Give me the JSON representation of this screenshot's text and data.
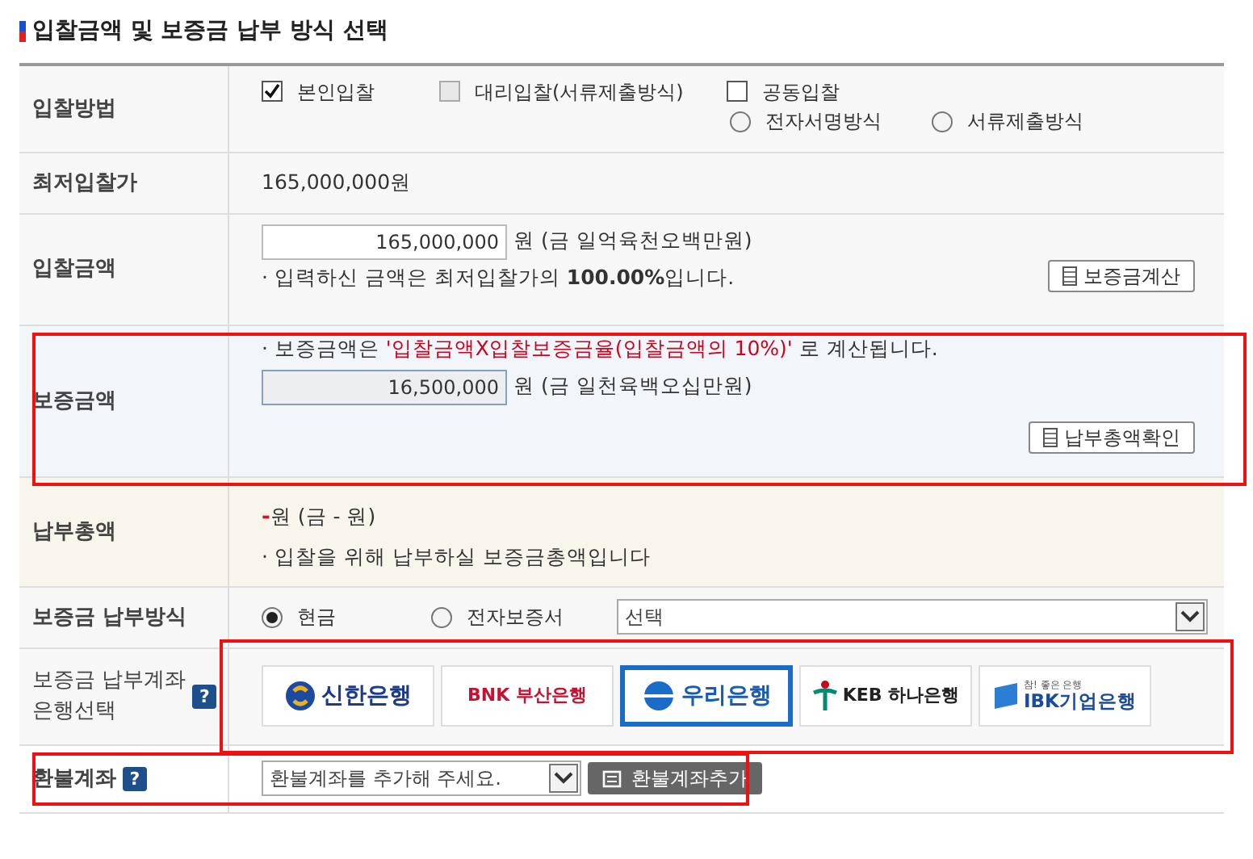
{
  "section_title": "입찰금액 및 보증금 납부 방식 선택",
  "rows": [
    {
      "kind": "bid-method",
      "label": "입찰방법",
      "highlighted": false,
      "options": [
        {
          "label": "본인입찰",
          "checked": true,
          "disabled": false
        },
        {
          "label": "대리입찰(서류제출방식)",
          "checked": false,
          "disabled": true
        },
        {
          "label": "공동입찰",
          "checked": false,
          "disabled": false
        }
      ],
      "sub_options": [
        {
          "label": "전자서명방식",
          "selected": false
        },
        {
          "label": "서류제출방식",
          "selected": false
        }
      ]
    },
    {
      "kind": "text",
      "label": "최저입찰가",
      "highlighted": false,
      "value": "165,000,000원"
    },
    {
      "kind": "amount",
      "label": "입찰금액",
      "highlighted": false,
      "input_value": "165,000,000",
      "readonly": false,
      "unit_text": "원 (금 일억육천오백만원)",
      "note": "· 입력하신 금액은 최저입찰가의 **100.00%**입니다.",
      "button": "보증금계산"
    },
    {
      "kind": "guarantee",
      "label": "보증금액",
      "highlighted": true,
      "note_before": "· 보증금액은 ",
      "note_highlight": "'입찰금액X입찰보증금율(입찰금액의 10%)'",
      "note_after": " 로 계산됩니다.",
      "input_value": "16,500,000",
      "readonly": true,
      "unit_text": "원 (금 일천육백오십만원)",
      "button": "납부총액확인"
    },
    {
      "kind": "total",
      "label": "납부총액",
      "highlighted": false,
      "amount": "-",
      "unit_text": "원 (금 - 원)",
      "note": "· 입찰을 위해 납부하실 보증금총액입니다"
    },
    {
      "kind": "payment",
      "label": "보증금 납부방식",
      "highlighted": false,
      "options": [
        {
          "label": "현금",
          "selected": true
        },
        {
          "label": "전자보증서",
          "selected": false
        }
      ],
      "select_value": "선택"
    },
    {
      "kind": "banks",
      "label_lines": [
        "보증금 납부계좌",
        "은행선택"
      ],
      "help": "?",
      "highlighted": true,
      "banks": [
        {
          "name": "신한은행",
          "kind": "shinhan",
          "selected": false
        },
        {
          "name": "BNK 부산은행",
          "kind": "bnk",
          "selected": false
        },
        {
          "name": "우리은행",
          "kind": "woori",
          "selected": true
        },
        {
          "name": "KEB 하나은행",
          "kind": "hana",
          "selected": false
        },
        {
          "name": "IBK기업은행",
          "tagline": "참! 좋은 은행",
          "kind": "ibk",
          "selected": false
        }
      ]
    },
    {
      "kind": "refund",
      "label": "환불계좌",
      "help": "?",
      "highlighted": true,
      "select_value": "환불계좌를 추가해 주세요.",
      "button": "환불계좌추가"
    }
  ]
}
